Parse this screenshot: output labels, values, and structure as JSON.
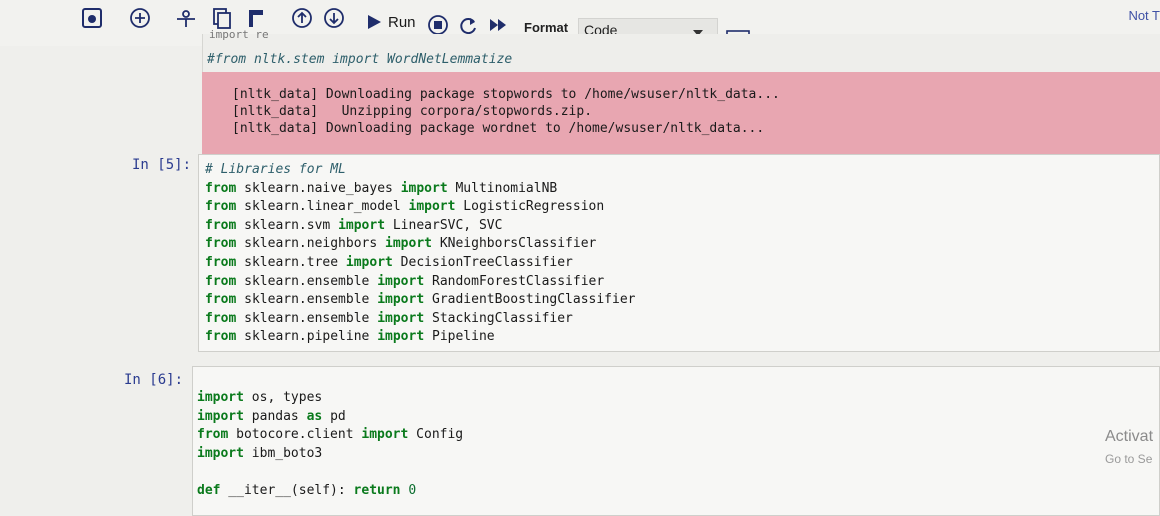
{
  "toolbar": {
    "run_label": "Run",
    "format_label": "Format",
    "cell_type": "Code",
    "trust_label": "Not T",
    "icons": [
      "save-icon",
      "add-cell-icon",
      "cut-icon",
      "copy-icon",
      "paste-icon",
      "move-up-icon",
      "move-down-icon",
      "run-icon",
      "interrupt-icon",
      "restart-icon",
      "restart-run-all-icon",
      "command-palette-icon"
    ]
  },
  "cells": {
    "prev": {
      "partial_line": "import re",
      "line": "#from nltk.stem import WordNetLemmatize"
    },
    "stderr": {
      "lines": [
        "[nltk_data] Downloading package stopwords to /home/wsuser/nltk_data...",
        "[nltk_data]   Unzipping corpora/stopwords.zip.",
        "[nltk_data] Downloading package wordnet to /home/wsuser/nltk_data..."
      ]
    },
    "cell5": {
      "prompt": "In [5]:",
      "comment": "# Libraries for ML",
      "lines": [
        {
          "a": "from",
          "b": " sklearn.naive_bayes ",
          "c": "import",
          "d": " MultinomialNB"
        },
        {
          "a": "from",
          "b": " sklearn.linear_model ",
          "c": "import",
          "d": " LogisticRegression"
        },
        {
          "a": "from",
          "b": " sklearn.svm ",
          "c": "import",
          "d": " LinearSVC, SVC"
        },
        {
          "a": "from",
          "b": " sklearn.neighbors ",
          "c": "import",
          "d": " KNeighborsClassifier"
        },
        {
          "a": "from",
          "b": " sklearn.tree ",
          "c": "import",
          "d": " DecisionTreeClassifier"
        },
        {
          "a": "from",
          "b": " sklearn.ensemble ",
          "c": "import",
          "d": " RandomForestClassifier"
        },
        {
          "a": "from",
          "b": " sklearn.ensemble ",
          "c": "import",
          "d": " GradientBoostingClassifier"
        },
        {
          "a": "from",
          "b": " sklearn.ensemble ",
          "c": "import",
          "d": " StackingClassifier"
        },
        {
          "a": "from",
          "b": " sklearn.pipeline ",
          "c": "import",
          "d": " Pipeline"
        }
      ]
    },
    "cell6": {
      "prompt": "In [6]:",
      "l1": {
        "a": "import",
        "b": " os, types"
      },
      "l2": {
        "a": "import",
        "b": " pandas ",
        "c": "as",
        "d": " pd"
      },
      "l3": {
        "a": "from",
        "b": " botocore.client ",
        "c": "import",
        "d": " Config"
      },
      "l4": {
        "a": "import",
        "b": " ibm_boto3"
      },
      "l5": {
        "a": "def",
        "b": " __iter__(self): ",
        "c": "return",
        "d": " 0"
      }
    }
  },
  "watermark": {
    "title": "Activat",
    "subtitle": "Go to Se"
  }
}
